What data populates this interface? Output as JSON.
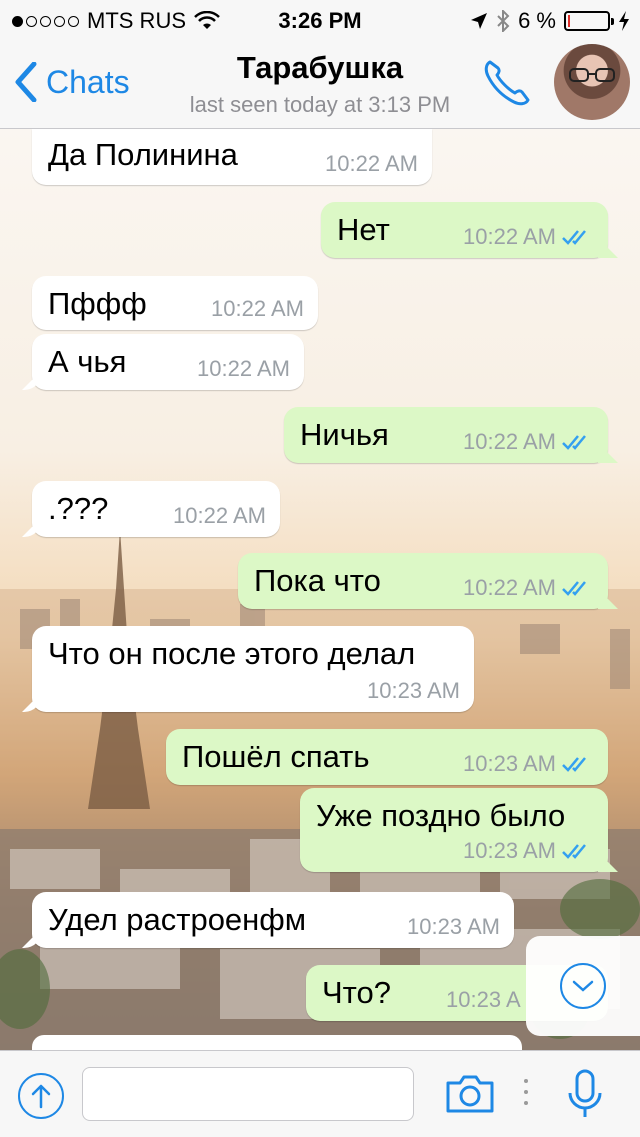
{
  "status_bar": {
    "signal_filled": 1,
    "signal_total": 5,
    "carrier": "MTS RUS",
    "time": "3:26 PM",
    "battery_percent": "6 %",
    "battery_level": 0.06
  },
  "nav": {
    "back_label": "Chats",
    "title": "Тарабушка",
    "subtitle": "last seen today at 3:13 PM"
  },
  "messages": [
    {
      "direction": "in",
      "text": "Да Полинина",
      "time": "10:22 AM"
    },
    {
      "direction": "out",
      "text": "Нет",
      "time": "10:22 AM",
      "read": true
    },
    {
      "direction": "in",
      "text": "Пффф",
      "time": "10:22 AM"
    },
    {
      "direction": "in",
      "text": "А чья",
      "time": "10:22 AM"
    },
    {
      "direction": "out",
      "text": "Ничья",
      "time": "10:22 AM",
      "read": true
    },
    {
      "direction": "in",
      "text": ".???",
      "time": "10:22 AM"
    },
    {
      "direction": "out",
      "text": "Пока что",
      "time": "10:22 AM",
      "read": true
    },
    {
      "direction": "in",
      "text": "Что он после этого делал",
      "time": "10:23 AM"
    },
    {
      "direction": "out",
      "text": "Пошёл спать",
      "time": "10:23 AM",
      "read": true
    },
    {
      "direction": "out",
      "text": "Уже поздно было",
      "time": "10:23 AM",
      "read": true
    },
    {
      "direction": "in",
      "text": "Удел растроенфм",
      "time": "10:23 AM"
    },
    {
      "direction": "out",
      "text": "Что?",
      "time": "10:23 A"
    }
  ],
  "input": {
    "placeholder": "",
    "value": ""
  },
  "colors": {
    "accent": "#1e88e5",
    "outgoing_bubble": "#dcf8c6",
    "incoming_bubble": "#ffffff",
    "battery_low": "#e0302a"
  }
}
